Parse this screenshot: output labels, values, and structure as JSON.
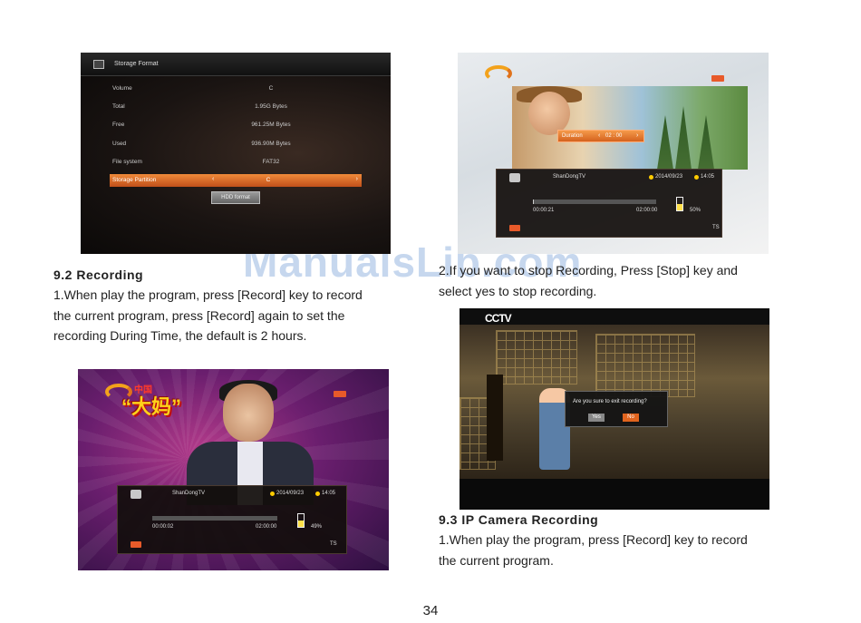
{
  "watermark": "ManualsLib.com",
  "section_9_2": {
    "heading": "9.2  Recording",
    "para1_lines": [
      "1.When play the program, press [Record] key to record",
      "the current program, press [Record] again to set the",
      "recording During Time, the default is 2 hours."
    ],
    "para2_lines": [
      "2.If you want to stop Recording, Press [Stop] key and",
      "select yes to stop recording."
    ]
  },
  "section_9_3": {
    "heading": "9.3  IP Camera Recording",
    "para_lines": [
      "1.When play the program, press [Record] key to record",
      "the current program."
    ]
  },
  "page_number": "34",
  "storage_screen": {
    "title": "Storage Format",
    "rows": [
      {
        "label": "Volume",
        "value": "C"
      },
      {
        "label": "Total",
        "value": "1.95G Bytes"
      },
      {
        "label": "Free",
        "value": "961.25M Bytes"
      },
      {
        "label": "Used",
        "value": "936.90M Bytes"
      },
      {
        "label": "File system",
        "value": "FAT32"
      }
    ],
    "partition": {
      "label": "Storage Partition",
      "value": "C"
    },
    "format_button": "HDD format",
    "accent_color": "#e8702a"
  },
  "duration_screen": {
    "popup_label": "Duration",
    "popup_value": "02 : 00",
    "info": {
      "channel": "ShanDongTV",
      "date": "2014/09/23",
      "time": "14:05",
      "elapsed": "00:00:21",
      "total": "02:00:00",
      "disk_percent": "50%",
      "disk_fraction": 0.5,
      "progress_fraction": 0.01,
      "ts": "TS"
    }
  },
  "exit_screen": {
    "logo": "CCTV",
    "question": "Are you sure to exit recording?",
    "yes": "Yes",
    "no": "No"
  },
  "recbar_screen": {
    "show_title": "“大妈”",
    "show_sub": "中国",
    "info": {
      "channel": "ShanDongTV",
      "date": "2014/09/23",
      "time": "14:05",
      "elapsed": "00:00:02",
      "total": "02:00:00",
      "disk_percent": "49%",
      "disk_fraction": 0.49,
      "progress_fraction": 0.0,
      "ts": "TS"
    }
  }
}
